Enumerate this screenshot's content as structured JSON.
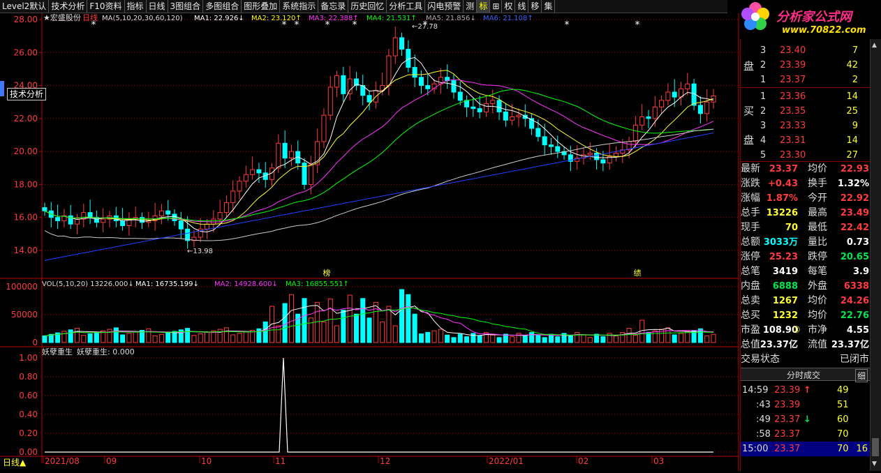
{
  "toolbar": {
    "items": [
      "Level2默认",
      "技术分析",
      "F10资料",
      "指标",
      "日线",
      "3图组合",
      "多图组合",
      "图形叠加",
      "系统指示",
      "备忘录",
      "历史回忆",
      "分析工具",
      "闪电预警",
      "测",
      "标",
      "⊞",
      "权",
      "线",
      "移",
      "集"
    ]
  },
  "logo": {
    "title": "分析家公式网",
    "url": "www.70822.com"
  },
  "stock": {
    "name": "宏盛股份",
    "period": "日线"
  },
  "tooltip": "技术分析",
  "ma_legend": {
    "label": "MA(5,10,20,30,60,120)",
    "ma1": "MA1: 22.926↓",
    "ma2": "MA2: 23.120↑",
    "ma3": "MA3: 22.388↑",
    "ma4": "MA4: 21.531↑",
    "ma5": "MA5: 21.856↓",
    "ma6": "MA6: 21.108↑"
  },
  "price_axis": [
    "28.00",
    "26.00",
    "24.00",
    "22.00",
    "20.00",
    "18.00",
    "16.00",
    "14.00"
  ],
  "annotations": {
    "high": "27.78",
    "low": "13.98",
    "mark1": "榜",
    "mark2": "绩"
  },
  "vol_legend": {
    "label": "VOL(5,10,20) 13226.000↓",
    "ma1": "MA1: 16735.199↓",
    "ma2": "MA2: 14928.600↓",
    "ma3": "MA3: 16855.551↑"
  },
  "vol_axis": [
    "100000",
    "50000",
    "0"
  ],
  "ind_legend": {
    "name": "妖孽重生",
    "value": "妖孽重生: 0.000"
  },
  "ind_axis": [
    "1.00",
    "0.80",
    "0.60",
    "0.40",
    "0.20",
    "0.00"
  ],
  "date_axis": [
    "2021/08",
    "09",
    "10",
    "11",
    "12",
    "2022/01",
    "02",
    "03"
  ],
  "bottom_label": "日线▲",
  "orderbook": {
    "sell": [
      {
        "level": "3",
        "price": "23.40",
        "vol": "7"
      },
      {
        "level": "2",
        "price": "23.39",
        "vol": "42"
      },
      {
        "level": "1",
        "price": "23.37",
        "vol": "2"
      }
    ],
    "buy": [
      {
        "level": "1",
        "price": "23.36",
        "vol": "14"
      },
      {
        "level": "2",
        "price": "23.35",
        "vol": "25"
      },
      {
        "level": "3",
        "price": "23.33",
        "vol": "9"
      },
      {
        "level": "4",
        "price": "23.31",
        "vol": "14"
      },
      {
        "level": "5",
        "price": "23.30",
        "vol": "27"
      }
    ],
    "sell_label": "盘",
    "buy_label1": "买",
    "buy_label2": "盘"
  },
  "stats": [
    {
      "k1": "最新",
      "v1": "23.37",
      "k2": "均价",
      "v2": "22.93"
    },
    {
      "k1": "涨跌",
      "v1": "+0.43",
      "k2": "换手",
      "v2": "1.32%"
    },
    {
      "k1": "涨幅",
      "v1": "1.87%",
      "k2": "今开",
      "v2": "22.92"
    },
    {
      "k1": "总手",
      "v1": "13226",
      "k2": "最高",
      "v2": "23.49"
    },
    {
      "k1": "现手",
      "v1": "70",
      "k2": "最低",
      "v2": "22.42"
    },
    {
      "k1": "总额",
      "v1": "3033万",
      "k2": "量比",
      "v2": "0.73"
    },
    {
      "k1": "涨停",
      "v1": "25.23",
      "k2": "跌停",
      "v2": "20.65"
    },
    {
      "k1": "总笔",
      "v1": "3419",
      "k2": "每笔",
      "v2": "3.9"
    },
    {
      "k1": "内盘",
      "v1": "6888",
      "k2": "外盘",
      "v2": "6338"
    },
    {
      "k1": "总卖",
      "v1": "1267",
      "k2": "均价",
      "v2": "24.26"
    },
    {
      "k1": "总买",
      "v1": "1232",
      "k2": "均价",
      "v2": "22.76"
    },
    {
      "k1": "市盈",
      "v1": "108.90",
      "k1b": "③",
      "k2": "市净",
      "v2": "4.55"
    },
    {
      "k1": "总值",
      "v1": "23.37亿",
      "k2": "流值",
      "v2": "23.37亿"
    }
  ],
  "status": {
    "label": "交易状态",
    "value": "已闭市"
  },
  "ticks_header": {
    "title": "分时成交",
    "btn": "细"
  },
  "ticks": [
    {
      "time": "14:59",
      "price": "23.39",
      "arrow": "↑",
      "vol": "49",
      "extra": ""
    },
    {
      "time": ":43",
      "price": "23.39",
      "arrow": "",
      "vol": "51",
      "extra": ""
    },
    {
      "time": ":49",
      "price": "23.37",
      "arrow": "↓",
      "vol": "60",
      "extra": ""
    },
    {
      "time": ":58",
      "price": "23.37",
      "arrow": "",
      "vol": "70",
      "extra": ""
    },
    {
      "time": "15:00",
      "price": "23.37",
      "arrow": "",
      "vol": "70",
      "extra": "16"
    }
  ],
  "chart_data": {
    "type": "candlestick",
    "title": "宏盛股份 日线",
    "x_range": [
      "2021/08",
      "2022/03"
    ],
    "price_range": [
      13,
      28
    ],
    "closes": [
      16.4,
      16.0,
      15.8,
      16.1,
      15.6,
      15.9,
      16.3,
      16.0,
      15.7,
      15.9,
      16.1,
      15.8,
      15.5,
      15.9,
      16.0,
      15.7,
      15.8,
      16.1,
      16.4,
      16.2,
      15.8,
      15.3,
      14.6,
      14.8,
      15.3,
      15.6,
      15.9,
      16.3,
      16.9,
      17.6,
      18.2,
      18.6,
      18.9,
      18.7,
      18.3,
      19.0,
      20.5,
      19.6,
      20.0,
      19.3,
      18.0,
      19.2,
      20.6,
      22.2,
      23.9,
      24.6,
      23.5,
      24.4,
      24.0,
      23.4,
      23.0,
      23.7,
      24.0,
      25.8,
      26.9,
      26.2,
      25.1,
      24.5,
      24.0,
      23.8,
      24.1,
      24.5,
      24.3,
      23.6,
      23.1,
      22.7,
      22.6,
      22.4,
      22.9,
      23.1,
      22.4,
      21.9,
      22.1,
      22.2,
      22.0,
      21.4,
      20.9,
      20.4,
      20.3,
      20.0,
      19.8,
      19.4,
      19.6,
      19.8,
      19.9,
      19.5,
      19.3,
      19.7,
      19.9,
      20.1,
      20.6,
      21.6,
      22.1,
      22.0,
      22.7,
      23.1,
      23.6,
      23.3,
      23.8,
      24.1,
      22.8,
      22.3,
      23.0,
      23.37
    ],
    "volume_range": [
      0,
      100000
    ],
    "indicator": {
      "name": "妖孽重生",
      "range": [
        0,
        1
      ],
      "spike_value": 1.0
    }
  }
}
